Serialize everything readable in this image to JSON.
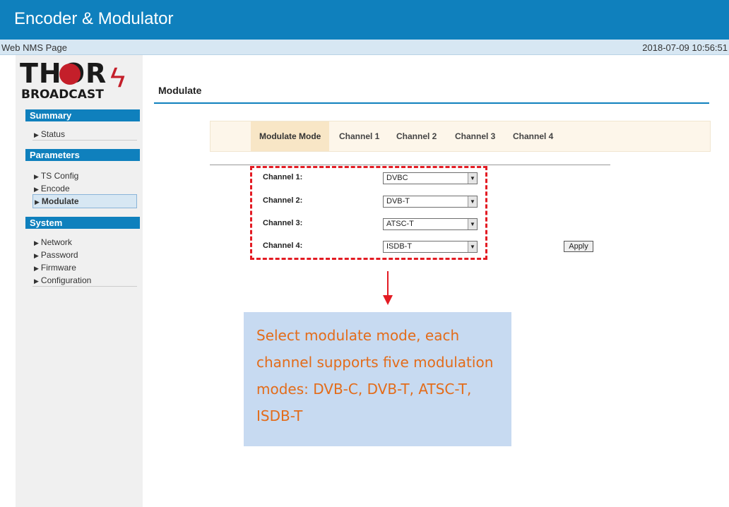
{
  "header": {
    "title": "Encoder & Modulator"
  },
  "subbar": {
    "left": "Web NMS Page",
    "datetime": "2018-07-09 10:56:51"
  },
  "logo": {
    "line1": "THOR",
    "line2": "BROADCAST"
  },
  "sidebar": {
    "summary": {
      "heading": "Summary",
      "items": [
        "Status"
      ]
    },
    "parameters": {
      "heading": "Parameters",
      "items": [
        "TS Config",
        "Encode",
        "Modulate"
      ]
    },
    "system": {
      "heading": "System",
      "items": [
        "Network",
        "Password",
        "Firmware",
        "Configuration"
      ]
    }
  },
  "page": {
    "title": "Modulate"
  },
  "tabs": [
    "Modulate Mode",
    "Channel 1",
    "Channel 2",
    "Channel 3",
    "Channel 4"
  ],
  "form": {
    "rows": [
      {
        "label": "Channel 1:",
        "value": "DVBC"
      },
      {
        "label": "Channel 2:",
        "value": "DVB-T"
      },
      {
        "label": "Channel 3:",
        "value": "ATSC-T"
      },
      {
        "label": "Channel 4:",
        "value": "ISDB-T"
      }
    ],
    "apply": "Apply"
  },
  "annotation": {
    "text": "Select modulate mode, each channel supports five modulation modes: DVB-C, DVB-T, ATSC-T, ISDB-T",
    "color": "#e36c1a",
    "box_color": "#c7daf1",
    "marker_color": "#e31b23"
  },
  "colors": {
    "accent": "#0f80bd",
    "tab_bg": "#fdf6ea",
    "tab_active": "#f8e6c6"
  }
}
